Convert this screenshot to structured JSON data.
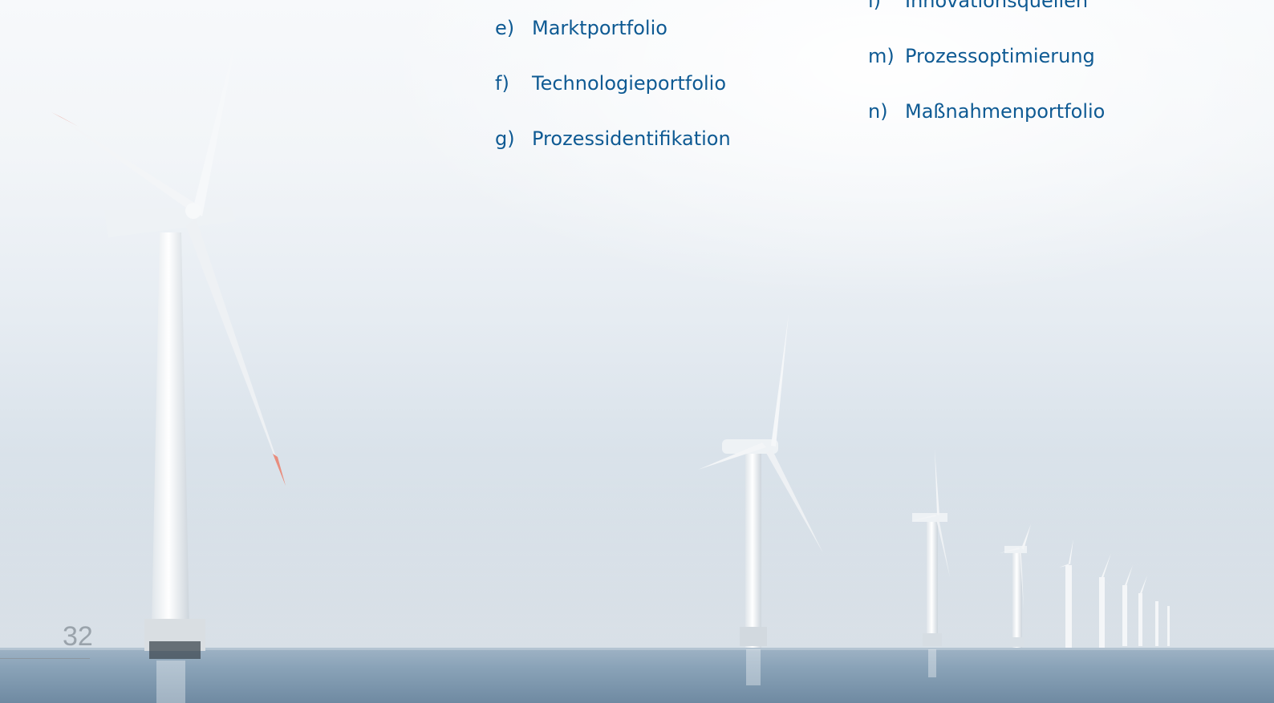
{
  "document": {
    "page_number": "32",
    "list_left": [
      {
        "letter": "e)",
        "text": "Marktportfolio"
      },
      {
        "letter": "f)",
        "text": "Technologieportfolio"
      },
      {
        "letter": "g)",
        "text": "Prozessidentifikation"
      }
    ],
    "list_right": [
      {
        "letter": "l)",
        "text": "Innovationsquellen"
      },
      {
        "letter": "m)",
        "text": "Prozessoptimierung"
      },
      {
        "letter": "n)",
        "text": "Maßnahmenportfolio"
      }
    ]
  },
  "colors": {
    "text_blue": "#0e5a93",
    "page_number_gray": "#9aa3ab",
    "sky_top": "#f7f9fb",
    "sea": "#8ea6bb"
  },
  "image": {
    "subject": "offshore-wind-turbines"
  }
}
